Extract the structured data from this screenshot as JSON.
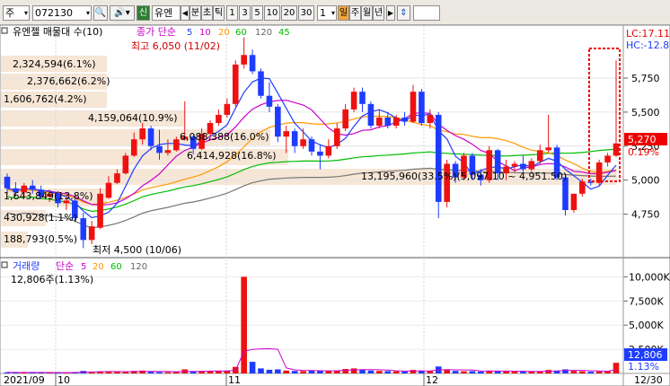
{
  "toolbar": {
    "market": "주",
    "code": "072130",
    "badge": "신",
    "name": "유엔",
    "tabs": [
      "분",
      "초",
      "틱"
    ],
    "periods": [
      "1",
      "3",
      "5",
      "10",
      "20",
      "30"
    ],
    "period_selected": "1",
    "units": [
      "일",
      "주",
      "월",
      "년"
    ],
    "unit_selected": "일"
  },
  "legend": {
    "title": "유엔젤 매물대 수(10)",
    "ma_label": "종가 단순",
    "ma": [
      {
        "n": "5",
        "color": "#1e3cff"
      },
      {
        "n": "10",
        "color": "#cc00cc"
      },
      {
        "n": "20",
        "color": "#ff9900"
      },
      {
        "n": "60",
        "color": "#00bb00"
      },
      {
        "n": "120",
        "color": "#666666"
      },
      {
        "n": "45",
        "color": "#00bb00"
      }
    ],
    "volume_title": "거래량",
    "volume_ma_label": "단순",
    "volume_ma": [
      {
        "n": "5",
        "color": "#cc00cc"
      },
      {
        "n": "20",
        "color": "#ff9900"
      },
      {
        "n": "60",
        "color": "#00bb00"
      },
      {
        "n": "120",
        "color": "#666666"
      }
    ]
  },
  "right_labels": {
    "lc": "LC:17.11",
    "hc": "HC:-12.8",
    "last_price": "5,270",
    "last_pct": "0.19%",
    "vol_box": "12,806",
    "vol_pct": "1.13%"
  },
  "annotations": {
    "high": "최고 6,050 (11/02)",
    "low": "최저 4,500 (10/06)",
    "volume_summary": "12,806주(1.13%)",
    "range_label": "13,195,960(33.5%)(5,097.10 ~ 4,951.50)"
  },
  "volume_profile": [
    {
      "label": "2,324,594(6.1%)"
    },
    {
      "label": "2,376,662(6.2%)"
    },
    {
      "label": "1,606,762(4.2%)"
    },
    {
      "label": "4,159,064(10.9%)"
    },
    {
      "label": "6,088,388(16.0%)"
    },
    {
      "label": "6,414,928(16.8%)"
    },
    {
      "label": "13,195,960"
    },
    {
      "label": "1,643,849(13.8%)"
    },
    {
      "label": "430,928(1.1%)"
    },
    {
      "label": "188,793(0.5%)"
    }
  ],
  "price_axis": [
    "5,750",
    "5,500",
    "5,250",
    "5,000",
    "4,750"
  ],
  "volume_axis": [
    "10,000K",
    "7,500K",
    "5,000K",
    "2,500K"
  ],
  "date_axis": [
    "2021/09",
    "10",
    "11",
    "12",
    "12/30"
  ],
  "chart_data": {
    "type": "candlestick",
    "candles": [
      {
        "o": 5025,
        "h": 5050,
        "l": 4900,
        "c": 4940
      },
      {
        "o": 4940,
        "h": 4985,
        "l": 4880,
        "c": 4910
      },
      {
        "o": 4910,
        "h": 4980,
        "l": 4870,
        "c": 4960
      },
      {
        "o": 4960,
        "h": 5000,
        "l": 4900,
        "c": 4930
      },
      {
        "o": 4930,
        "h": 4960,
        "l": 4860,
        "c": 4880
      },
      {
        "o": 4880,
        "h": 4930,
        "l": 4840,
        "c": 4900
      },
      {
        "o": 4900,
        "h": 4920,
        "l": 4800,
        "c": 4830
      },
      {
        "o": 4830,
        "h": 4880,
        "l": 4780,
        "c": 4850
      },
      {
        "o": 4850,
        "h": 4860,
        "l": 4700,
        "c": 4720
      },
      {
        "o": 4720,
        "h": 4760,
        "l": 4500,
        "c": 4560
      },
      {
        "o": 4560,
        "h": 4700,
        "l": 4530,
        "c": 4660
      },
      {
        "o": 4650,
        "h": 4940,
        "l": 4640,
        "c": 4900
      },
      {
        "o": 4870,
        "h": 5030,
        "l": 4860,
        "c": 4980
      },
      {
        "o": 4980,
        "h": 5080,
        "l": 4970,
        "c": 5050
      },
      {
        "o": 5050,
        "h": 5200,
        "l": 5040,
        "c": 5180
      },
      {
        "o": 5180,
        "h": 5350,
        "l": 5170,
        "c": 5300
      },
      {
        "o": 5300,
        "h": 5420,
        "l": 5260,
        "c": 5380
      },
      {
        "o": 5380,
        "h": 5400,
        "l": 5220,
        "c": 5250
      },
      {
        "o": 5250,
        "h": 5370,
        "l": 5150,
        "c": 5200
      },
      {
        "o": 5200,
        "h": 5300,
        "l": 5180,
        "c": 5220
      },
      {
        "o": 5220,
        "h": 5320,
        "l": 5210,
        "c": 5300
      },
      {
        "o": 5300,
        "h": 5580,
        "l": 5290,
        "c": 5320
      },
      {
        "o": 5320,
        "h": 5330,
        "l": 5190,
        "c": 5230
      },
      {
        "o": 5230,
        "h": 5380,
        "l": 5220,
        "c": 5340
      },
      {
        "o": 5340,
        "h": 5440,
        "l": 5300,
        "c": 5420
      },
      {
        "o": 5420,
        "h": 5520,
        "l": 5400,
        "c": 5480
      },
      {
        "o": 5480,
        "h": 5600,
        "l": 5460,
        "c": 5560
      },
      {
        "o": 5560,
        "h": 5880,
        "l": 5540,
        "c": 5850
      },
      {
        "o": 5850,
        "h": 6050,
        "l": 5820,
        "c": 5920
      },
      {
        "o": 5920,
        "h": 5960,
        "l": 5780,
        "c": 5800
      },
      {
        "o": 5800,
        "h": 5820,
        "l": 5600,
        "c": 5620
      },
      {
        "o": 5620,
        "h": 5720,
        "l": 5500,
        "c": 5540
      },
      {
        "o": 5540,
        "h": 5560,
        "l": 5280,
        "c": 5320
      },
      {
        "o": 5320,
        "h": 5400,
        "l": 5200,
        "c": 5360
      },
      {
        "o": 5360,
        "h": 5380,
        "l": 5200,
        "c": 5250
      },
      {
        "o": 5250,
        "h": 5380,
        "l": 5230,
        "c": 5300
      },
      {
        "o": 5300,
        "h": 5320,
        "l": 5180,
        "c": 5210
      },
      {
        "o": 5210,
        "h": 5260,
        "l": 5080,
        "c": 5180
      },
      {
        "o": 5180,
        "h": 5300,
        "l": 5160,
        "c": 5250
      },
      {
        "o": 5250,
        "h": 5420,
        "l": 5230,
        "c": 5380
      },
      {
        "o": 5380,
        "h": 5560,
        "l": 5360,
        "c": 5520
      },
      {
        "o": 5520,
        "h": 5680,
        "l": 5500,
        "c": 5650
      },
      {
        "o": 5650,
        "h": 5680,
        "l": 5500,
        "c": 5560
      },
      {
        "o": 5560,
        "h": 5580,
        "l": 5380,
        "c": 5400
      },
      {
        "o": 5400,
        "h": 5520,
        "l": 5380,
        "c": 5460
      },
      {
        "o": 5460,
        "h": 5500,
        "l": 5380,
        "c": 5400
      },
      {
        "o": 5400,
        "h": 5480,
        "l": 5380,
        "c": 5460
      },
      {
        "o": 5460,
        "h": 5500,
        "l": 5400,
        "c": 5430
      },
      {
        "o": 5430,
        "h": 5700,
        "l": 5420,
        "c": 5650
      },
      {
        "o": 5650,
        "h": 5670,
        "l": 5400,
        "c": 5420
      },
      {
        "o": 5420,
        "h": 5520,
        "l": 5380,
        "c": 5480
      },
      {
        "o": 5480,
        "h": 5500,
        "l": 4720,
        "c": 4840
      },
      {
        "o": 4840,
        "h": 5150,
        "l": 4800,
        "c": 5120
      },
      {
        "o": 5120,
        "h": 5140,
        "l": 4980,
        "c": 5020
      },
      {
        "o": 5020,
        "h": 5200,
        "l": 5000,
        "c": 5180
      },
      {
        "o": 5180,
        "h": 5200,
        "l": 5000,
        "c": 5040
      },
      {
        "o": 5040,
        "h": 5080,
        "l": 4960,
        "c": 5000
      },
      {
        "o": 5000,
        "h": 5250,
        "l": 4980,
        "c": 5220
      },
      {
        "o": 5220,
        "h": 5230,
        "l": 5000,
        "c": 5050
      },
      {
        "o": 5050,
        "h": 5150,
        "l": 5000,
        "c": 5100
      },
      {
        "o": 5100,
        "h": 5140,
        "l": 5060,
        "c": 5120
      },
      {
        "o": 5120,
        "h": 5180,
        "l": 5060,
        "c": 5080
      },
      {
        "o": 5080,
        "h": 5160,
        "l": 5060,
        "c": 5140
      },
      {
        "o": 5140,
        "h": 5260,
        "l": 5120,
        "c": 5220
      },
      {
        "o": 5220,
        "h": 5480,
        "l": 5200,
        "c": 5240
      },
      {
        "o": 5240,
        "h": 5260,
        "l": 5000,
        "c": 5020
      },
      {
        "o": 5020,
        "h": 5040,
        "l": 4740,
        "c": 4780
      },
      {
        "o": 4780,
        "h": 4900,
        "l": 4760,
        "c": 4900
      },
      {
        "o": 4900,
        "h": 5010,
        "l": 4880,
        "c": 4990
      },
      {
        "o": 4990,
        "h": 5010,
        "l": 4960,
        "c": 4980
      },
      {
        "o": 4980,
        "h": 5150,
        "l": 4960,
        "c": 5130
      },
      {
        "o": 5130,
        "h": 5200,
        "l": 5100,
        "c": 5180
      },
      {
        "o": 5180,
        "h": 5880,
        "l": 5170,
        "c": 5270
      }
    ],
    "volumes": [
      120,
      90,
      110,
      80,
      95,
      70,
      100,
      85,
      140,
      260,
      180,
      220,
      160,
      140,
      200,
      260,
      300,
      180,
      140,
      130,
      150,
      420,
      220,
      180,
      240,
      260,
      310,
      680,
      10000,
      1200,
      520,
      380,
      420,
      300,
      260,
      240,
      300,
      280,
      250,
      320,
      460,
      520,
      380,
      300,
      260,
      240,
      220,
      200,
      360,
      300,
      240,
      720,
      360,
      260,
      220,
      240,
      200,
      300,
      240,
      220,
      200,
      180,
      190,
      220,
      360,
      300,
      420,
      260,
      220,
      180,
      200,
      260,
      1100
    ]
  }
}
